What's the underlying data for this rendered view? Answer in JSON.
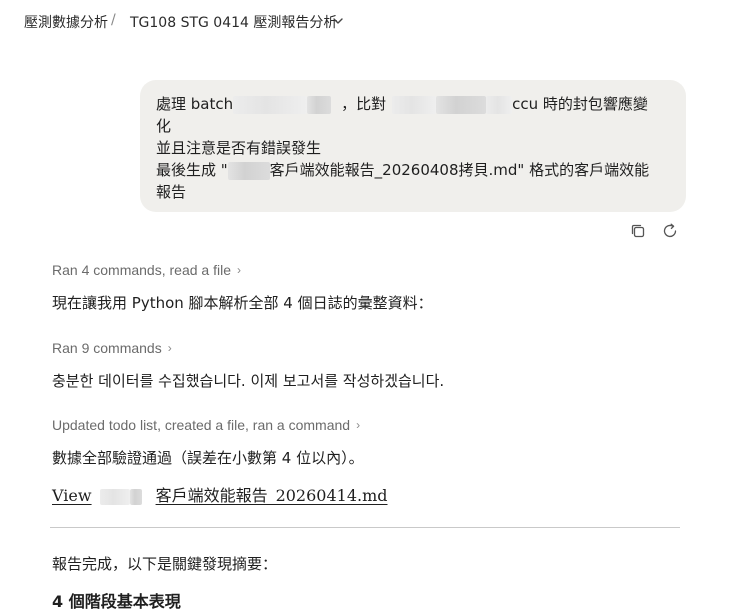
{
  "header": {
    "project": "壓測數據分析",
    "separator": "/",
    "title": "TG108 STG 0414 壓測報告分析"
  },
  "user_message": {
    "line1_prefix": "處理 batch",
    "line1_mid": "，比對",
    "line1_suffix": "ccu 時的封包響應變",
    "line2": "化",
    "line3": "並且注意是否有錯誤發生",
    "line4_prefix": "最後生成 \"",
    "line4_suffix": "客戶端效能報告_20260408拷貝.md\" 格式的客戶端效能",
    "line5": "報告"
  },
  "steps": [
    {
      "label": "Ran 4 commands, read a file"
    },
    {
      "label": "Ran 9 commands"
    },
    {
      "label": "Updated todo list, created a file, ran a command"
    }
  ],
  "responses": {
    "r1": "現在讓我用 Python 腳本解析全部 4 個日誌的彙整資料：",
    "r2": "충분한 데이터를 수집했습니다. 이제 보고서를 작성하겠습니다.",
    "r3": "數據全部驗證通過（誤差在小數第 4 位以內）。"
  },
  "file_link": {
    "prefix": "View",
    "suffix": "客戶端效能報告_20260414.md"
  },
  "summary": {
    "intro": "報告完成，以下是關鍵發現摘要：",
    "heading": "4 個階段基本表現"
  },
  "icons": {
    "chevron": "chevron-down-icon",
    "copy": "copy-icon",
    "retry": "retry-icon",
    "expand": "chevron-right-icon"
  }
}
